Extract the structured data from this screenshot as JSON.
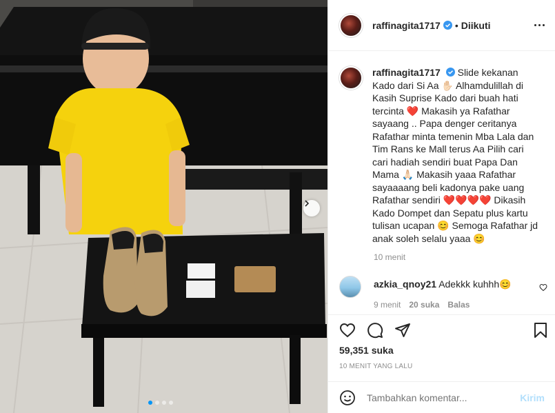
{
  "post": {
    "username": "raffinagita1717",
    "follow_status": "Diikuti",
    "caption_parts": [
      "Slide kekanan Kado dari Si Aa ",
      "✋🏻",
      " Alhamdulillah di Kasih Suprise Kado dari buah hati tercinta ",
      "❤️",
      " Makasih ya Rafathar sayaang .. Papa denger ceritanya Rafathar minta temenin Mba Lala dan Tim Rans ke Mall terus Aa Pilih cari cari hadiah sendiri buat Papa Dan Mama ",
      "🙏🏻",
      " Makasih yaaa Rafathar sayaaaang beli kadonya pake uang Rafathar sendiri ",
      "❤️❤️❤️❤️",
      " Dikasih Kado Dompet dan Sepatu plus kartu tulisan ucapan ",
      "😊",
      " Semoga Rafathar jd anak soleh selalu yaaa ",
      "😊"
    ],
    "caption_time": "10 menit",
    "likes": "59,351 suka",
    "posted_ago": "10 MENIT YANG LALU"
  },
  "comment": {
    "username": "azkia_qnoy21",
    "text": "Adekkk kuhhh",
    "emoji": "😊",
    "time": "9 menit",
    "likes": "20 suka",
    "reply_label": "Balas"
  },
  "add_comment": {
    "placeholder": "Tambahkan komentar...",
    "post_label": "Kirim"
  },
  "carousel": {
    "slide_count": 4,
    "current_slide": 1
  },
  "colors": {
    "accent": "#0095f6",
    "verified": "#3897f0",
    "muted": "#8e8e8e",
    "heart": "#ed4956",
    "post_disabled": "#b2dffc"
  },
  "icons": [
    "verified-icon",
    "more-options-icon",
    "heart-icon",
    "comment-icon",
    "share-icon",
    "save-icon",
    "emoji-icon",
    "chevron-right-icon"
  ]
}
